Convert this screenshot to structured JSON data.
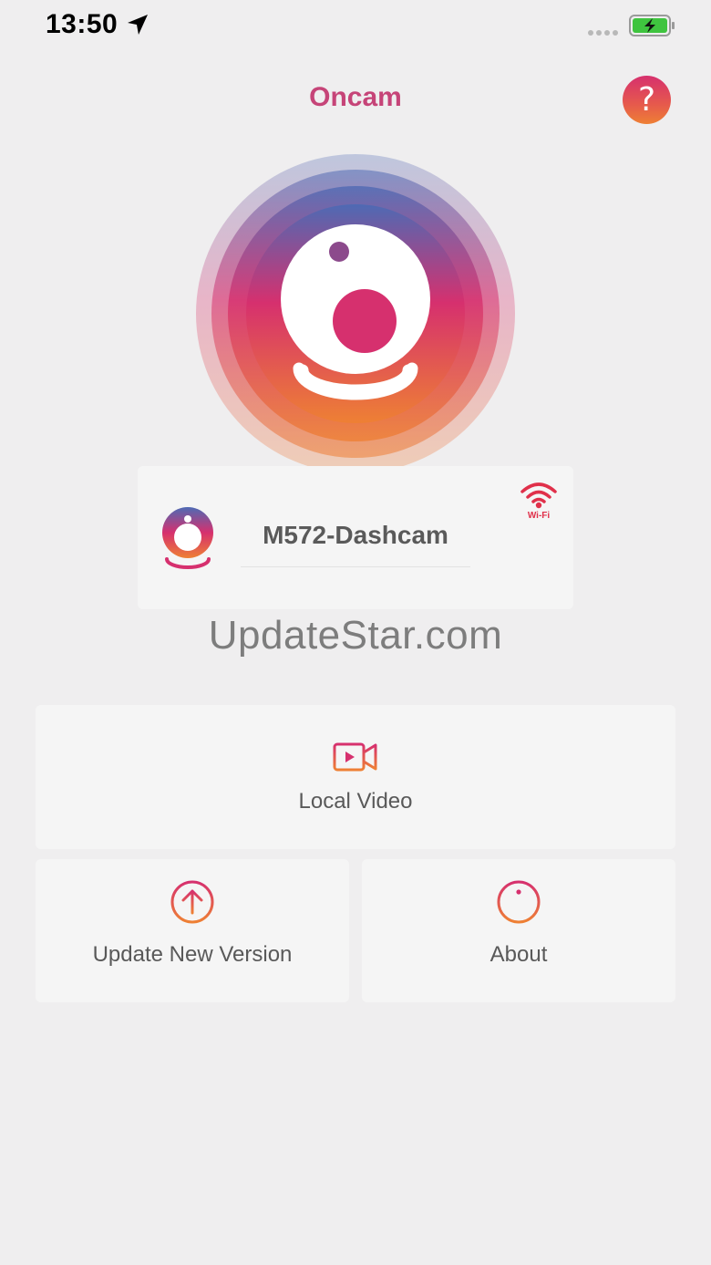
{
  "status_bar": {
    "time": "13:50",
    "icons": [
      "location-arrow-icon",
      "signal-dots-icon",
      "battery-charging-icon"
    ],
    "battery_color": "#3fc43f"
  },
  "header": {
    "title": "Oncam",
    "help_label": "?"
  },
  "device": {
    "name": "M572-Dashcam",
    "wifi_label": "Wi-Fi"
  },
  "watermark": "UpdateStar.com",
  "menu": {
    "local_video": "Local Video",
    "update": "Update New Version",
    "about": "About"
  },
  "colors": {
    "brand_pink": "#d6306e",
    "brand_orange": "#ee8034",
    "brand_blue": "#4e6ab4",
    "title": "#c64478"
  }
}
